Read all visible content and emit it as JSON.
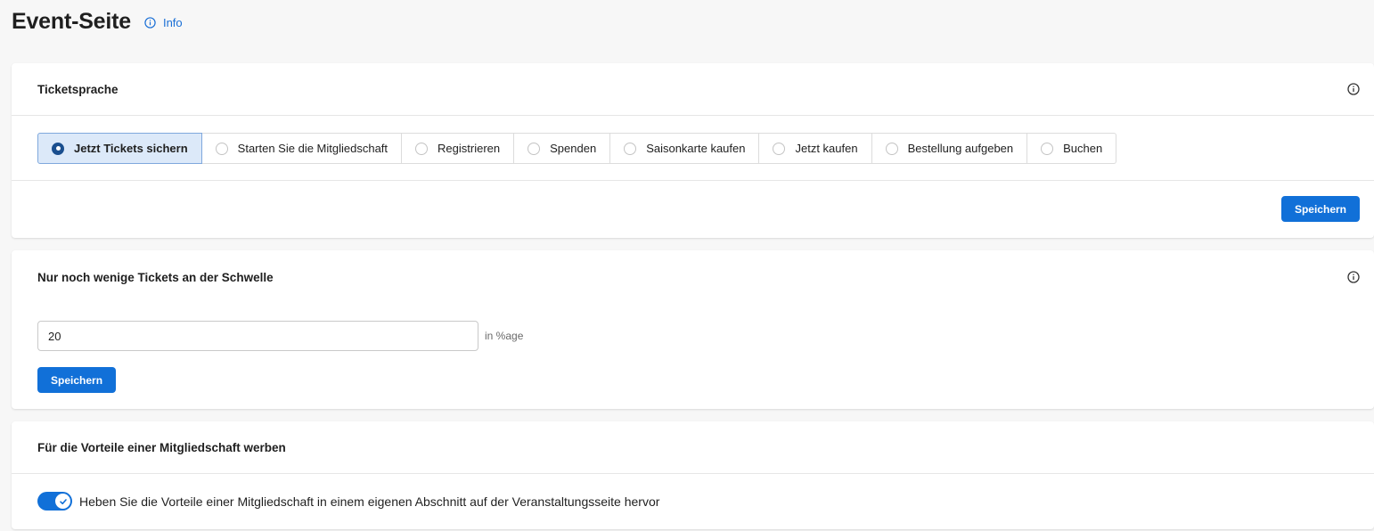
{
  "page": {
    "title": "Event-Seite",
    "info_link": "Info"
  },
  "ticket_language": {
    "title": "Ticketsprache",
    "options": [
      "Jetzt Tickets sichern",
      "Starten Sie die Mitgliedschaft",
      "Registrieren",
      "Spenden",
      "Saisonkarte kaufen",
      "Jetzt kaufen",
      "Bestellung aufgeben",
      "Buchen"
    ],
    "selected_index": 0,
    "save_label": "Speichern"
  },
  "threshold": {
    "title": "Nur noch wenige Tickets an der Schwelle",
    "value": "20",
    "unit": "in %age",
    "save_label": "Speichern"
  },
  "membership": {
    "title": "Für die Vorteile einer Mitgliedschaft werben",
    "toggle_on": true,
    "toggle_label": "Heben Sie die Vorteile einer Mitgliedschaft in einem eigenen Abschnitt auf der Veranstaltungsseite hervor"
  },
  "colors": {
    "accent": "#1170d8",
    "selected_bg": "#dce9f9",
    "info_link": "#1a6fd6"
  },
  "icons": {
    "info": "info-circle-icon",
    "check": "check-icon"
  }
}
